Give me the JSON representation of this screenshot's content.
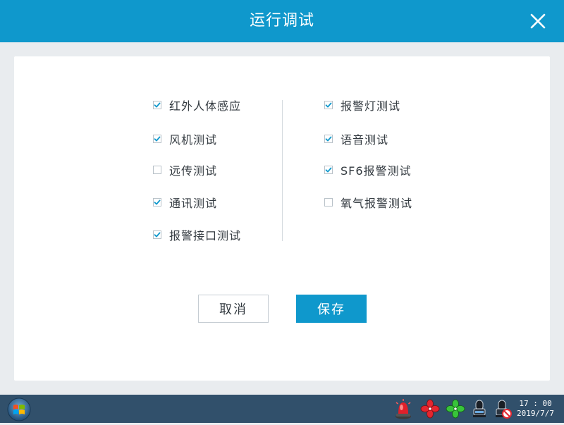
{
  "window": {
    "title": "运行调试"
  },
  "options_left": [
    {
      "label": "红外人体感应",
      "checked": true
    },
    {
      "label": "风机测试",
      "checked": true
    },
    {
      "label": "远传测试",
      "checked": false
    },
    {
      "label": "通讯测试",
      "checked": true
    },
    {
      "label": "报警接口测试",
      "checked": true
    }
  ],
  "options_right": [
    {
      "label": "报警灯测试",
      "checked": true
    },
    {
      "label": "语音测试",
      "checked": true
    },
    {
      "label": "SF6报警测试",
      "checked": true
    },
    {
      "label": "氧气报警测试",
      "checked": false
    }
  ],
  "buttons": {
    "cancel": "取消",
    "save": "保存"
  },
  "taskbar": {
    "time": "17 : 00",
    "date": "2019/7/7",
    "tray_icons": [
      "alarm-light-icon",
      "fan-red-icon",
      "fan-green-icon",
      "sensor-icon",
      "sensor-disabled-icon"
    ]
  },
  "colors": {
    "accent": "#0f98cc",
    "taskbar": "#31506b",
    "check": "#0f98cc"
  }
}
